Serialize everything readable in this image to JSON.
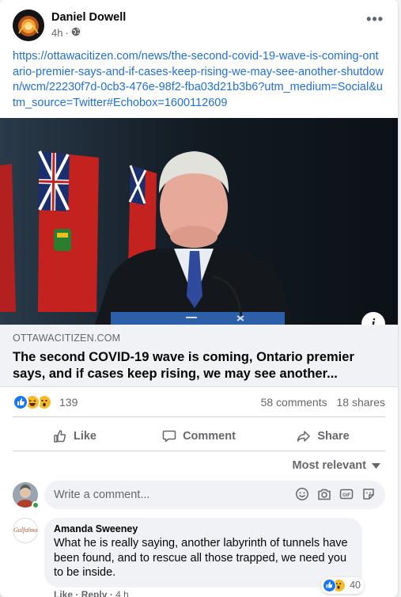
{
  "post": {
    "author": "Daniel Dowell",
    "time": "4h",
    "separator": "·",
    "link_text": "https://ottawacitizen.com/news/the-second-covid-19-wave-is-coming-ontario-premier-says-and-if-cases-keep-rising-we-may-see-another-shutdown/wcm/22230f7d-0cb3-476e-98f2-fba03d21b3b6?utm_medium=Social&utm_source=Twitter#Echobox=1600112609",
    "more_label": "•••"
  },
  "link_preview": {
    "domain": "OTTAWACITIZEN.COM",
    "title": "The second COVID-19 wave is coming, Ontario premier says, and if cases keep rising, we may see another...",
    "info_label": "i"
  },
  "stats": {
    "reaction_count": "139",
    "comments": "58 comments",
    "shares": "18 shares"
  },
  "actions": {
    "like": "Like",
    "comment": "Comment",
    "share": "Share"
  },
  "sort": {
    "label": "Most relevant"
  },
  "composer": {
    "placeholder": "Write a comment..."
  },
  "comment": {
    "author": "Amanda Sweeney",
    "text": "What he is really saying, another labyrinth of tunnels have been found, and to rescue all those trapped, we need you to be inside.",
    "reaction_count": "40",
    "like": "Like",
    "reply": "Reply",
    "sep": "·",
    "time": "4 h",
    "avatar_text": "Gulfalma"
  },
  "colors": {
    "link": "#216fdb",
    "like_blue": "#1877f2",
    "secondary": "#65676b"
  }
}
